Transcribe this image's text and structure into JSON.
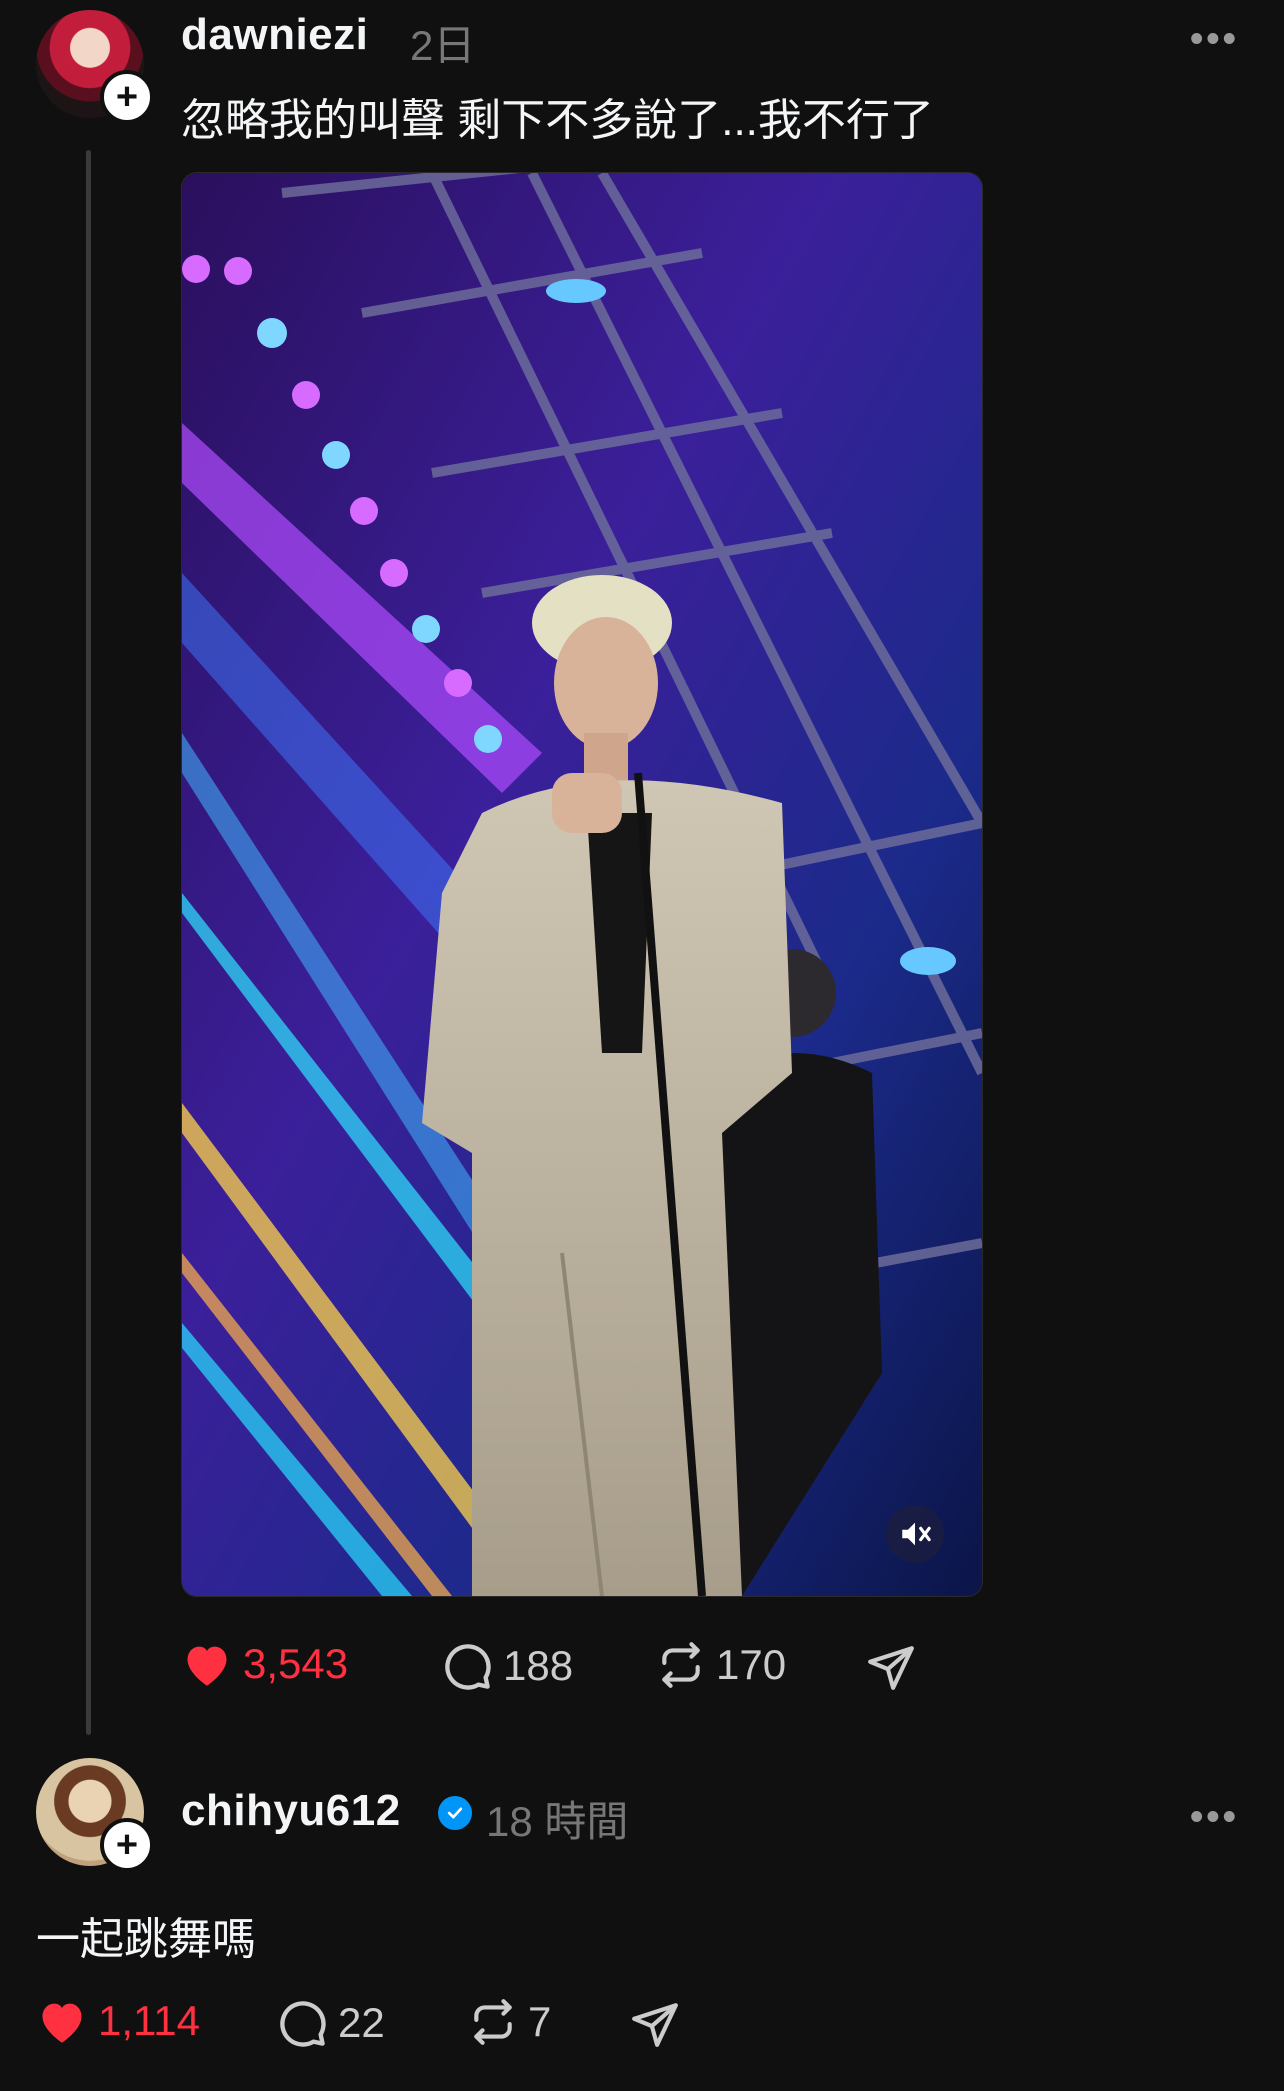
{
  "post": {
    "username": "dawniezi",
    "time": "2日",
    "text": "忽略我的叫聲 剩下不多說了...我不行了",
    "likes": "3,543",
    "comments": "188",
    "reposts": "170",
    "more": "•••"
  },
  "reply": {
    "username": "chihyu612",
    "time": "18 時間",
    "text": "一起跳舞嗎",
    "likes": "1,114",
    "comments": "22",
    "reposts": "7",
    "more": "•••"
  },
  "colors": {
    "background": "#101010",
    "like": "#ff3040",
    "verified": "#0095f6"
  },
  "icons": [
    "heart-icon",
    "comment-icon",
    "repost-icon",
    "share-icon",
    "muted-speaker-icon",
    "plus-icon",
    "verified-badge-icon",
    "more-icon"
  ]
}
